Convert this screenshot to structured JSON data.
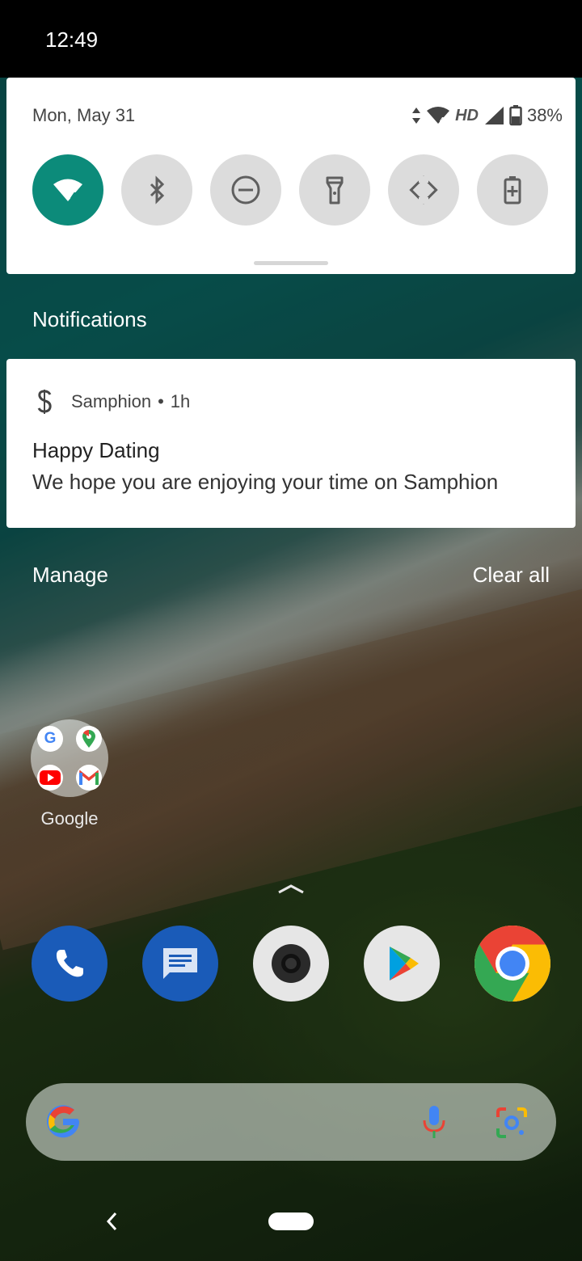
{
  "status_bar": {
    "time": "12:49",
    "battery_percent": "38%",
    "network_label": "HD"
  },
  "quick_settings": {
    "date": "Mon, May 31",
    "tiles": [
      {
        "name": "wifi",
        "icon": "wifi-icon",
        "active": true
      },
      {
        "name": "bluetooth",
        "icon": "bluetooth-icon",
        "active": false
      },
      {
        "name": "do-not-disturb",
        "icon": "dnd-icon",
        "active": false
      },
      {
        "name": "flashlight",
        "icon": "flashlight-icon",
        "active": false
      },
      {
        "name": "auto-rotate",
        "icon": "rotate-icon",
        "active": false
      },
      {
        "name": "battery-saver",
        "icon": "battery-saver-icon",
        "active": false
      }
    ],
    "accent_color": "#0c8b7a"
  },
  "notifications": {
    "header": "Notifications",
    "items": [
      {
        "app_name": "Samphion",
        "separator": "•",
        "time": "1h",
        "title": "Happy Dating",
        "body": "We hope you are enjoying your time on Samphion"
      }
    ],
    "manage_label": "Manage",
    "clear_all_label": "Clear all"
  },
  "home": {
    "folder_label": "Google",
    "folder_apps": [
      "google-icon",
      "maps-icon",
      "youtube-icon",
      "gmail-icon"
    ],
    "dock": [
      "phone-icon",
      "messages-icon",
      "camera-icon",
      "play-store-icon",
      "chrome-icon"
    ],
    "search_bar": {
      "logo": "google-g-icon",
      "mic": "mic-icon",
      "lens": "lens-icon"
    }
  }
}
